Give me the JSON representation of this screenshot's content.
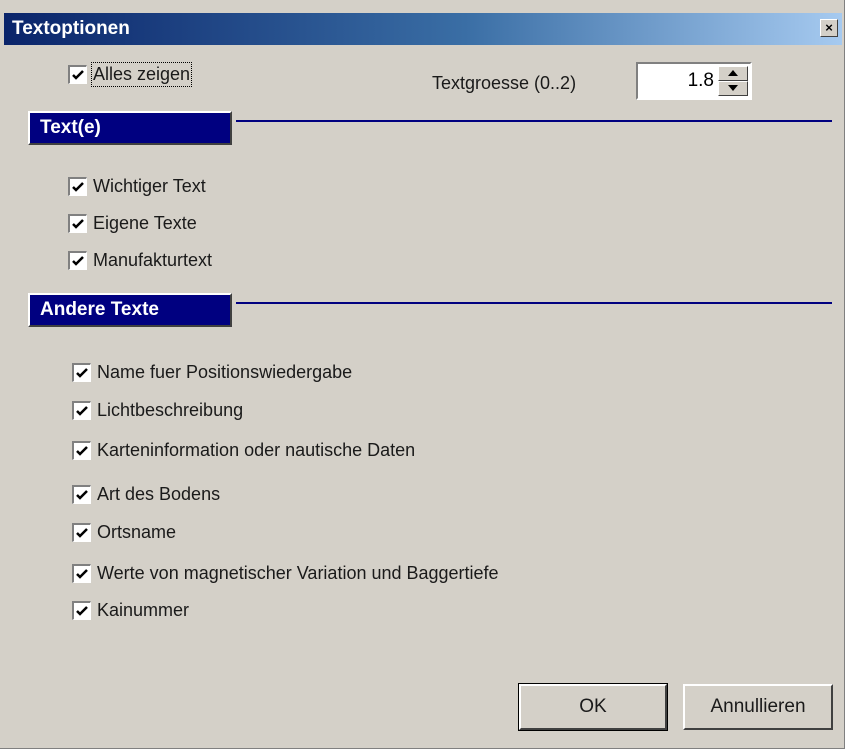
{
  "window": {
    "title": "Textoptionen",
    "close_glyph": "×"
  },
  "options": {
    "show_all": {
      "label": "Alles zeigen",
      "checked": true
    },
    "text_size": {
      "label": "Textgroesse (0..2)",
      "value": "1.8"
    }
  },
  "section_texts": {
    "header": "Text(e)",
    "items": [
      {
        "label": "Wichtiger Text",
        "checked": true
      },
      {
        "label": "Eigene Texte",
        "checked": true
      },
      {
        "label": "Manufakturtext",
        "checked": true
      }
    ]
  },
  "section_other": {
    "header": "Andere Texte",
    "items": [
      {
        "label": "Name fuer Positionswiedergabe",
        "checked": true
      },
      {
        "label": "Lichtbeschreibung",
        "checked": true
      },
      {
        "label": "Karteninformation oder nautische Daten",
        "checked": true
      },
      {
        "label": "Art des Bodens",
        "checked": true
      },
      {
        "label": "Ortsname",
        "checked": true
      },
      {
        "label": "Werte von magnetischer Variation und Baggertiefe",
        "checked": true
      },
      {
        "label": "Kainummer",
        "checked": true
      }
    ]
  },
  "buttons": {
    "ok": "OK",
    "cancel": "Annullieren"
  },
  "colors": {
    "face": "#d4d0c8",
    "title_start": "#0a246a",
    "title_end": "#a6caf0",
    "section": "#000080"
  }
}
